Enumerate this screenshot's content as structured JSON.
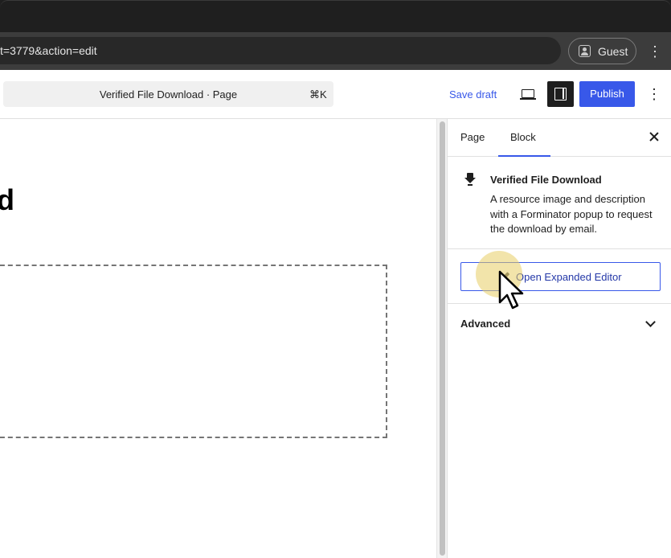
{
  "browser": {
    "url": "t=3779&action=edit",
    "profile_label": "Guest",
    "menu_glyph": "⋮"
  },
  "editor": {
    "document_title": "Verified File Download · Page",
    "shortcut": "⌘K",
    "save_draft_label": "Save draft",
    "publish_label": "Publish",
    "options_glyph": "⋮",
    "accent_color": "#3858e9"
  },
  "canvas": {
    "heading_fragment": "d"
  },
  "sidebar": {
    "tabs": [
      {
        "label": "Page",
        "active": false
      },
      {
        "label": "Block",
        "active": true
      }
    ],
    "block": {
      "icon": "download-icon",
      "title": "Verified File Download",
      "description": "A resource image and description with a Forminator popup to request the download by email."
    },
    "expand_button_label": "Open Expanded Editor",
    "advanced_label": "Advanced"
  }
}
